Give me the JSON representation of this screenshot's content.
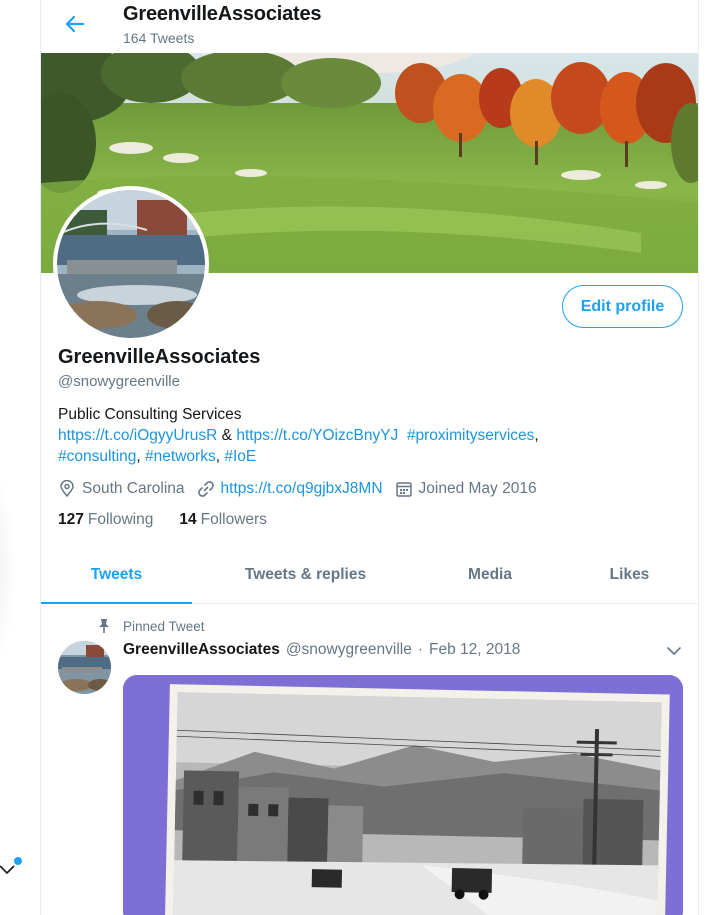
{
  "header": {
    "title": "GreenvilleAssociates",
    "tweet_count": "164 Tweets"
  },
  "profile": {
    "edit_button": "Edit profile",
    "display_name": "GreenvilleAssociates",
    "handle": "@snowygreenville",
    "bio_text": "Public Consulting Services",
    "bio_links": {
      "link1": "https://t.co/iOgyyUrusR",
      "amp": "&",
      "link2": "https://t.co/YOizcBnyYJ",
      "tag1": "#proximityservices",
      "comma1": ",",
      "tag2": "#consulting",
      "comma2": ",",
      "tag3": "#networks",
      "comma3": ",",
      "tag4": "#IoE"
    },
    "location": "South Carolina",
    "website": "https://t.co/q9gjbxJ8MN",
    "joined": "Joined May 2016",
    "following_count": "127",
    "following_label": "Following",
    "followers_count": "14",
    "followers_label": "Followers"
  },
  "tabs": [
    {
      "label": "Tweets",
      "active": true
    },
    {
      "label": "Tweets & replies",
      "active": false
    },
    {
      "label": "Media",
      "active": false
    },
    {
      "label": "Likes",
      "active": false
    }
  ],
  "pinned_tweet": {
    "pinned_label": "Pinned Tweet",
    "author_name": "GreenvilleAssociates",
    "author_handle": "@snowygreenville",
    "separator": "·",
    "date": "Feb 12, 2018"
  },
  "icons": {
    "back": "arrow-left-icon",
    "location": "location-pin-icon",
    "link": "link-icon",
    "calendar": "calendar-icon",
    "pin": "pin-icon",
    "caret": "chevron-down-icon"
  },
  "colors": {
    "accent": "#1da1f2",
    "link": "#1b95e0",
    "secondary_text": "#657786",
    "primary_text": "#14171a",
    "border": "#e6ecf0",
    "media_frame": "#7d6fd4"
  }
}
